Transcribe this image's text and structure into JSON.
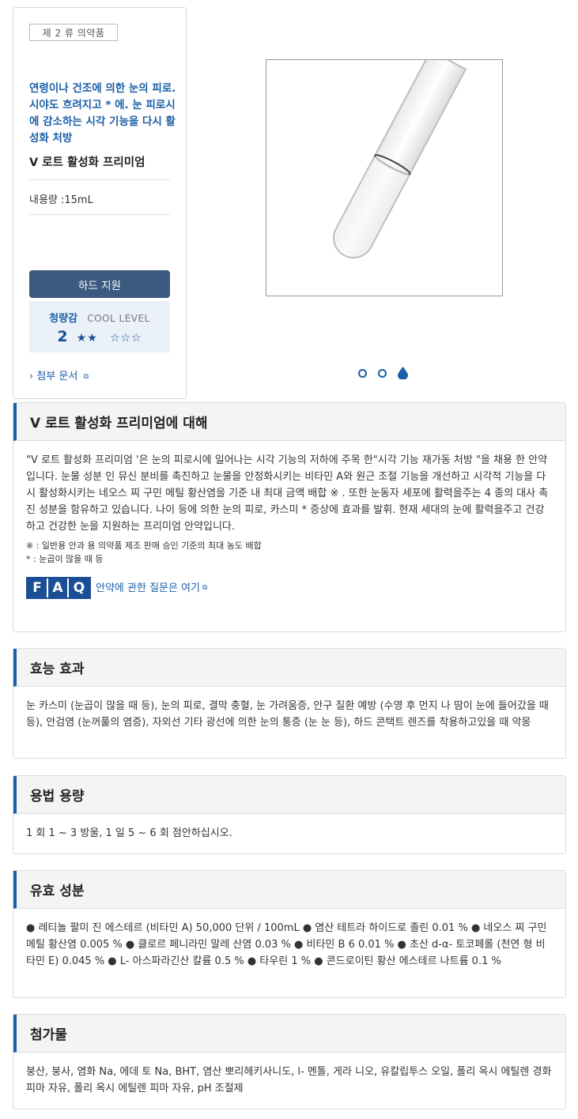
{
  "product": {
    "category": "제 2 류 의약품",
    "tagline": "연령이나 건조에 의한 눈의 피로. 시야도 흐려지고 * 에. 눈 피로시에 감소하는 시각 기능을 다시 활성화 처방",
    "name": "V 로트 활성화 프리미엄",
    "volume": "내용량 :15mL",
    "hard_button": "하드 지원",
    "cool_label": "청량감",
    "cool_level_label": "COOL LEVEL",
    "cool_value": "2",
    "cool_stars_filled": "★★",
    "cool_stars_empty": "☆☆☆",
    "attachment_link": "첨부 문서"
  },
  "carousel": {
    "count": 3,
    "active": 2
  },
  "sections": {
    "about": {
      "title": "V 로트 활성화 프리미엄에 대해",
      "body": "\"V 로트 활성화 프리미엄 '은 눈의 피로시에 일어나는 시각 기능의 저하에 주목 한\"시각 기능 재가동 처방 \"을 채용 한 안약입니다. 눈물 성분 인 뮤신 분비를 촉진하고 눈물을 안정화시키는 비타민 A와 원근 조절 기능을 개선하고 시각적 기능을 다시 활성화시키는 네오스 찌 구민 메틸 황산염을 기준 내 최대 금액 배합 ※ . 또한 눈동자 세포에 활력을주는 4 종의 대사 촉진 성분을 함유하고 있습니다. 나이 등에 의한 눈의 피로, 카스미 * 증상에 효과를 발휘. 현재 세대의 눈에 활력을주고 건강하고 건강한 눈을 지원하는 프리미엄 안약입니다.",
      "note1": "※ : 일반용 안과 용 의약품 제조 판매 승인 기준의 최대 농도 배합",
      "note2": "* : 눈곱이 많을 때 등",
      "faq_letters": [
        "F",
        "A",
        "Q"
      ],
      "faq_link": "안약에 관한 질문은 여기"
    },
    "efficacy": {
      "title": "효능 효과",
      "body": "눈 카스미 (눈곱이 많을 때 등), 눈의 피로, 결막 충혈, 눈 가려움증, 안구 질환 예방 (수영 후 먼지 나 땀이 눈에 들어갔을 때 등), 안검염 (눈꺼풀의 염증), 자외선 기타 광선에 의한 눈의 통증 (눈 눈 등), 하드 콘택트 렌즈를 착용하고있을 때 악몽"
    },
    "dosage": {
      "title": "용법 용량",
      "body": "1 회 1 ~ 3 방울, 1 일 5 ~ 6 회 점안하십시오."
    },
    "ingredients": {
      "title": "유효 성분",
      "body": "● 레티놀 팔미 진 에스테르 (비타민 A) 50,000 단위 / 100mL ● 염산 테트라 하이드로 졸린 0.01 % ● 네오스 찌 구민 메틸 황산염 0.005 % ● 클로르 페니라민 말레 산염 0.03 % ● 비타민 B 6 0.01 % ● 초산 d-α- 토코페롤 (천연 형 비타민 E) 0.045 % ● L- 아스파라긴산 칼륨 0.5 % ● 타우린 1 % ● 콘드로이틴 황산 에스테르 나트륨 0.1 %"
    },
    "additives": {
      "title": "첨가물",
      "body": "붕산, 붕사, 염화 Na, 에데 토 Na, BHT, 염산 뽀리헤키사니도, l- 멘톨, 게라 니오, 유칼립투스 오일, 폴리 옥시 에틸렌 경화 피마 자유, 폴리 옥시 에틸렌 피마 자유, pH 조절제"
    }
  },
  "colors": {
    "accent": "#1b5fa8",
    "button": "#3c5a7f",
    "cool_bg": "#eaf1f9",
    "section_head_bg": "#f4f4f4"
  }
}
